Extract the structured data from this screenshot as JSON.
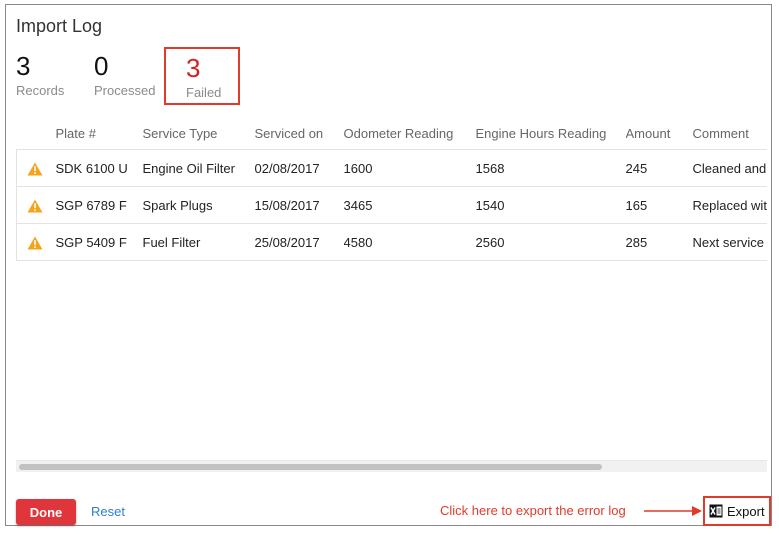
{
  "dialog": {
    "title": "Import Log"
  },
  "stats": {
    "records": {
      "value": "3",
      "label": "Records"
    },
    "processed": {
      "value": "0",
      "label": "Processed"
    },
    "failed": {
      "value": "3",
      "label": "Failed"
    }
  },
  "table": {
    "columns": [
      "Plate #",
      "Service Type",
      "Serviced on",
      "Odometer Reading",
      "Engine Hours Reading",
      "Amount",
      "Comment"
    ],
    "rows": [
      {
        "plate": "SDK 6100 U",
        "service_type": "Engine Oil Filter",
        "serviced_on": "02/08/2017",
        "odometer": "1600",
        "engine_hours": "1568",
        "amount": "245",
        "comment": "Cleaned and"
      },
      {
        "plate": "SGP 6789 F",
        "service_type": "Spark Plugs",
        "serviced_on": "15/08/2017",
        "odometer": "3465",
        "engine_hours": "1540",
        "amount": "165",
        "comment": "Replaced wit"
      },
      {
        "plate": "SGP 5409 F",
        "service_type": "Fuel Filter",
        "serviced_on": "25/08/2017",
        "odometer": "4580",
        "engine_hours": "2560",
        "amount": "285",
        "comment": "Next service"
      }
    ],
    "row_icon": "warning-icon"
  },
  "footer": {
    "done_label": "Done",
    "reset_label": "Reset",
    "annotation": "Click here to export the error log",
    "export_label": "Export",
    "export_icon": "excel-icon"
  },
  "colors": {
    "failed": "#d42020",
    "done_button": "#e0353a",
    "link": "#2a7fd4",
    "warning": "#f2a51a",
    "highlight": "#e03a2a"
  }
}
